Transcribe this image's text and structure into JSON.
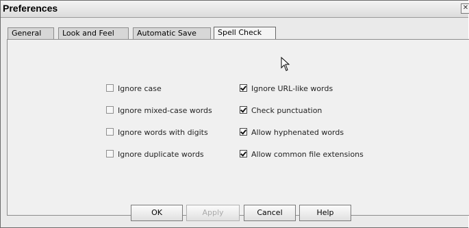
{
  "window": {
    "title": "Preferences",
    "close_icon": "close-icon"
  },
  "tabs": [
    {
      "label": "General",
      "active": false
    },
    {
      "label": "Look and Feel",
      "active": false
    },
    {
      "label": "Automatic Save",
      "active": false
    },
    {
      "label": "Spell Check",
      "active": true
    }
  ],
  "options": {
    "left": [
      {
        "label": "Ignore case",
        "checked": false
      },
      {
        "label": "Ignore mixed-case words",
        "checked": false
      },
      {
        "label": "Ignore words with digits",
        "checked": false
      },
      {
        "label": "Ignore duplicate words",
        "checked": false
      }
    ],
    "right": [
      {
        "label": "Ignore URL-like words",
        "checked": true
      },
      {
        "label": "Check punctuation",
        "checked": true
      },
      {
        "label": "Allow hyphenated words",
        "checked": true
      },
      {
        "label": "Allow common file extensions",
        "checked": true
      }
    ]
  },
  "buttons": {
    "ok": "OK",
    "apply": "Apply",
    "cancel": "Cancel",
    "help": "Help"
  }
}
